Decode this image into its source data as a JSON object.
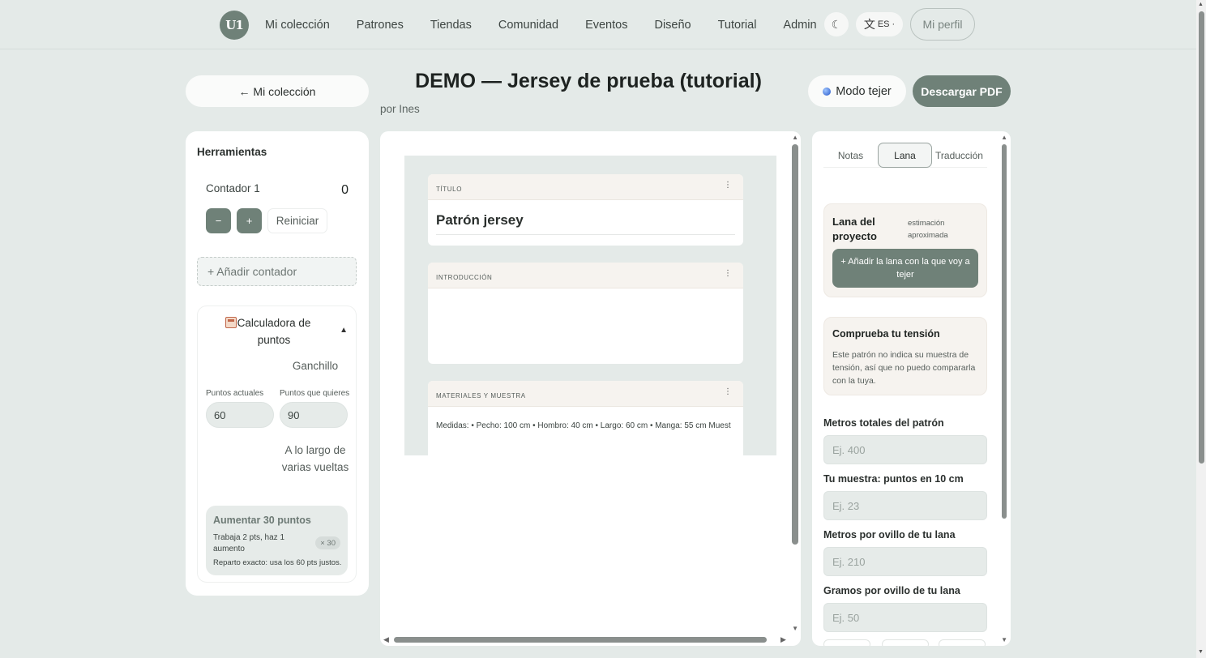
{
  "nav": {
    "logo_text": "U1",
    "links": [
      "Mi colección",
      "Patrones",
      "Tiendas",
      "Comunidad",
      "Eventos",
      "Diseño",
      "Tutorial",
      "Admin"
    ],
    "theme_icon": "☾",
    "lang_glyph": "文",
    "lang_code": "ES",
    "lang_caret": "·",
    "profile": "Mi perfil"
  },
  "header": {
    "back": "← Mi colección",
    "title": "DEMO — Jersey de prueba (tutorial)",
    "author": "por Ines",
    "knit_mode": "Modo tejer",
    "download": "Descargar PDF"
  },
  "tools": {
    "title": "Herramientas",
    "counter_name": "Contador 1",
    "counter_value": "0",
    "minus": "−",
    "plus": "+",
    "reset": "Reiniciar",
    "add_counter": "+ Añadir contador",
    "calc": {
      "title": "Calculadora de puntos",
      "caret": "▲",
      "mode": "Ganchillo",
      "current_label": "Puntos actuales",
      "current_value": "60",
      "target_label": "Puntos que quieres",
      "target_value": "90",
      "mode2": "A lo largo de varias vueltas",
      "result_title": "Aumentar 30 puntos",
      "result_line": "Trabaja 2 pts, haz 1 aumento",
      "result_badge": "× 30",
      "result_note": "Reparto exacto: usa los 60 pts justos."
    }
  },
  "document": {
    "cards": [
      {
        "label": "TÍTULO",
        "text": "Patrón jersey"
      },
      {
        "label": "INTRODUCCIÓN",
        "text": ""
      },
      {
        "label": "MATERIALES Y MUESTRA",
        "text": "Medidas: • Pecho: 100 cm • Hombro: 40 cm • Largo: 60 cm • Manga: 55 cm  Muest"
      }
    ],
    "menu_icon": "⋮"
  },
  "side": {
    "tabs": [
      "Notas",
      "Lana",
      "Traducción"
    ],
    "active_tab": "Lana",
    "yarn": {
      "title": "Lana del proyecto",
      "note": "estimación aproximada",
      "add": "+ Añadir la lana con la que voy a tejer"
    },
    "tension": {
      "title": "Comprueba tu tensión",
      "text": "Este patrón no indica su muestra de tensión, así que no puedo compararla con la tuya."
    },
    "fields": [
      {
        "label": "Metros totales del patrón",
        "placeholder": "Ej. 400"
      },
      {
        "label": "Tu muestra: puntos en 10 cm",
        "placeholder": "Ej. 23"
      },
      {
        "label": "Metros por ovillo de tu lana",
        "placeholder": "Ej. 210"
      },
      {
        "label": "Gramos por ovillo de tu lana",
        "placeholder": "Ej. 50"
      }
    ]
  },
  "colors": {
    "accent": "#6f8178",
    "background": "#e4eae8",
    "card_header": "#f6f3ef"
  }
}
